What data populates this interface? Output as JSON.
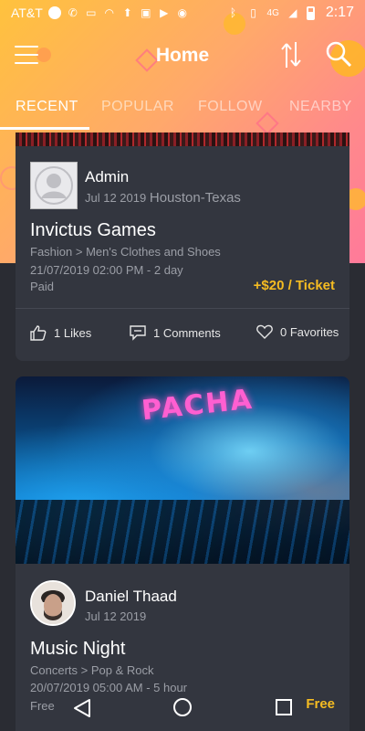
{
  "status_bar": {
    "carrier": "AT&T",
    "network": "4G",
    "time": "2:17"
  },
  "header": {
    "title": "Home"
  },
  "tabs": [
    {
      "label": "RECENT",
      "active": true
    },
    {
      "label": "POPULAR",
      "active": false
    },
    {
      "label": "FOLLOW",
      "active": false
    },
    {
      "label": "NEARBY",
      "active": false
    }
  ],
  "posts": [
    {
      "poster_name": "Admin",
      "date": "Jul 12 2019",
      "location": "Houston-Texas",
      "title": "Invictus Games",
      "category": "Fashion > Men's Clothes and Shoes",
      "time": "21/07/2019 02:00 PM - 2 day",
      "price_type": "Paid",
      "price": "+$20 / Ticket",
      "likes": "1 Likes",
      "comments": "1 Comments",
      "favorites": "0 Favorites"
    },
    {
      "image_sign": "PACHA",
      "poster_name": "Daniel Thaad",
      "date": "Jul 12 2019",
      "title": "Music Night",
      "category": "Concerts > Pop & Rock",
      "time": "20/07/2019 05:00 AM - 5 hour",
      "price_type": "Free",
      "price": "Free"
    }
  ],
  "colors": {
    "accent_price": "#f5bc22",
    "card_bg": "#33363f",
    "page_bg": "#2a2c33"
  }
}
